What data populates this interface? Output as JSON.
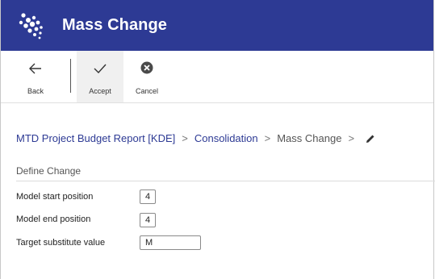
{
  "window": {
    "title": "Mass Change",
    "title_bg": "#2d3a94"
  },
  "toolbar": {
    "back_label": "Back",
    "accept_label": "Accept",
    "cancel_label": "Cancel"
  },
  "breadcrumb": {
    "items": [
      "MTD Project Budget Report [KDE]",
      "Consolidation",
      "Mass Change"
    ],
    "separator": ">"
  },
  "section": {
    "title": "Define Change"
  },
  "form": {
    "model_start_label": "Model start position",
    "model_start_value": "4",
    "model_end_label": "Model end position",
    "model_end_value": "4",
    "target_label": "Target substitute value",
    "target_value": "M"
  }
}
